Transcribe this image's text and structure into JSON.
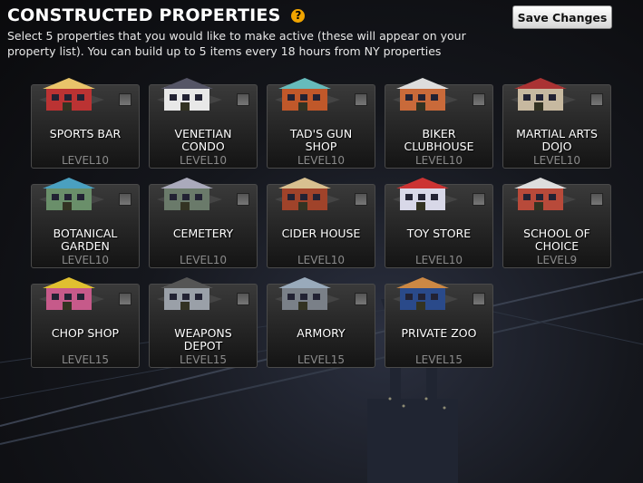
{
  "header": {
    "title": "CONSTRUCTED PROPERTIES",
    "help_icon": "question-mark-icon",
    "description": "Select 5 properties that you would like to make active (these will appear on your property list). You can build up to 5 items every 18 hours from NY properties"
  },
  "save_button": {
    "label": "Save Changes"
  },
  "colors": {
    "help_icon": "#f0a400",
    "level_text": "#8a8a8a"
  },
  "properties": [
    {
      "name": "SPORTS BAR",
      "level": "LEVEL10"
    },
    {
      "name": "VENETIAN CONDO",
      "level": "LEVEL10"
    },
    {
      "name": "TAD'S GUN SHOP",
      "level": "LEVEL10"
    },
    {
      "name": "BIKER CLUBHOUSE",
      "level": "LEVEL10"
    },
    {
      "name": "MARTIAL ARTS DOJO",
      "level": "LEVEL10"
    },
    {
      "name": "BOTANICAL GARDEN",
      "level": "LEVEL10"
    },
    {
      "name": "CEMETERY",
      "level": "LEVEL10"
    },
    {
      "name": "CIDER HOUSE",
      "level": "LEVEL10"
    },
    {
      "name": "TOY STORE",
      "level": "LEVEL10"
    },
    {
      "name": "SCHOOL OF CHOICE",
      "level": "LEVEL9"
    },
    {
      "name": "CHOP SHOP",
      "level": "LEVEL15"
    },
    {
      "name": "WEAPONS DEPOT",
      "level": "LEVEL15"
    },
    {
      "name": "ARMORY",
      "level": "LEVEL15"
    },
    {
      "name": "PRIVATE ZOO",
      "level": "LEVEL15"
    }
  ]
}
